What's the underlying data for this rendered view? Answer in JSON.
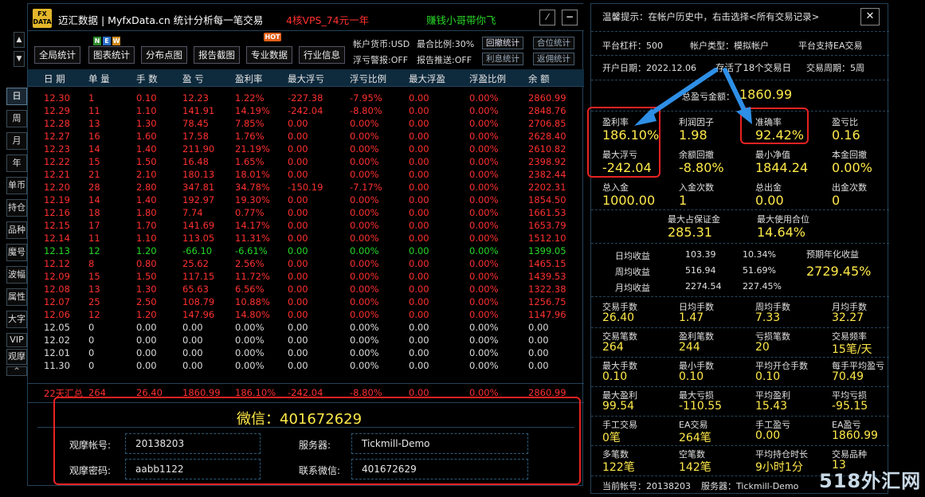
{
  "app": {
    "logo_text": "FX DATA",
    "title": "迈汇数据 | MyfxData.cn  统计分析每一笔交易",
    "ad1": "4核VPS_74元一年",
    "ad2": "赚钱小哥带你飞"
  },
  "toolbar": {
    "buttons": [
      "全局统计",
      "图表统计",
      "分布点图",
      "报告截图",
      "专业数据",
      "行业信息"
    ],
    "new_badge": [
      "N",
      "E",
      "W"
    ],
    "hot_badge": "HOT",
    "info": {
      "currency": "帐户货币:USD",
      "ratio": "最合比例:30%",
      "float_alert": "浮亏警报:OFF",
      "report_push": "报告推送:OFF"
    },
    "mini_buttons": [
      "回撤统计",
      "合位统计",
      "利息统计",
      "返佣统计"
    ]
  },
  "sidebar": {
    "arrows": [
      "▲",
      "▼"
    ],
    "items": [
      "日",
      "周",
      "月",
      "年",
      "单币",
      "持仓",
      "品种",
      "魔号",
      "波幅",
      "属性",
      "大字",
      "VIP",
      "观摩",
      "^"
    ]
  },
  "table": {
    "headers": [
      "日 期",
      "单 量",
      "手 数",
      "盈 亏",
      "盈利率",
      "最大浮亏",
      "浮亏比例",
      "最大浮盈",
      "浮盈比例",
      "余 额"
    ],
    "rows": [
      {
        "c": "red",
        "v": [
          "12.30",
          "1",
          "0.10",
          "12.23",
          "1.22%",
          "-227.38",
          "-7.95%",
          "0.00",
          "0.00%",
          "2860.99"
        ]
      },
      {
        "c": "red",
        "v": [
          "12.29",
          "11",
          "1.10",
          "141.91",
          "14.19%",
          "-242.04",
          "-8.80%",
          "0.00",
          "0.00%",
          "2848.76"
        ]
      },
      {
        "c": "red",
        "v": [
          "12.28",
          "13",
          "1.30",
          "78.45",
          "7.85%",
          "0.00",
          "0.00%",
          "0.00",
          "0.00%",
          "2706.85"
        ]
      },
      {
        "c": "red",
        "v": [
          "12.27",
          "16",
          "1.60",
          "17.58",
          "1.76%",
          "0.00",
          "0.00%",
          "0.00",
          "0.00%",
          "2628.40"
        ]
      },
      {
        "c": "red",
        "v": [
          "12.23",
          "14",
          "1.40",
          "211.90",
          "21.19%",
          "0.00",
          "0.00%",
          "0.00",
          "0.00%",
          "2610.82"
        ]
      },
      {
        "c": "red",
        "v": [
          "12.22",
          "15",
          "1.50",
          "16.48",
          "1.65%",
          "0.00",
          "0.00%",
          "0.00",
          "0.00%",
          "2398.92"
        ]
      },
      {
        "c": "red",
        "v": [
          "12.21",
          "21",
          "2.10",
          "180.13",
          "18.01%",
          "0.00",
          "0.00%",
          "0.00",
          "0.00%",
          "2382.44"
        ]
      },
      {
        "c": "red",
        "v": [
          "12.20",
          "28",
          "2.80",
          "347.81",
          "34.78%",
          "-150.19",
          "-7.17%",
          "0.00",
          "0.00%",
          "2202.31"
        ]
      },
      {
        "c": "red",
        "v": [
          "12.19",
          "14",
          "1.40",
          "192.97",
          "19.30%",
          "0.00",
          "0.00%",
          "0.00",
          "0.00%",
          "1854.50"
        ]
      },
      {
        "c": "red",
        "v": [
          "12.16",
          "18",
          "1.80",
          "7.74",
          "0.77%",
          "0.00",
          "0.00%",
          "0.00",
          "0.00%",
          "1661.53"
        ]
      },
      {
        "c": "red",
        "v": [
          "12.15",
          "17",
          "1.70",
          "141.69",
          "14.17%",
          "0.00",
          "0.00%",
          "0.00",
          "0.00%",
          "1653.79"
        ]
      },
      {
        "c": "red",
        "v": [
          "12.14",
          "11",
          "1.10",
          "113.05",
          "11.31%",
          "0.00",
          "0.00%",
          "0.00",
          "0.00%",
          "1512.10"
        ]
      },
      {
        "c": "green",
        "v": [
          "12.13",
          "12",
          "1.20",
          "-66.10",
          "-6.61%",
          "0.00",
          "0.00%",
          "0.00",
          "0.00%",
          "1399.05"
        ]
      },
      {
        "c": "red",
        "v": [
          "12.12",
          "8",
          "0.80",
          "25.62",
          "2.56%",
          "0.00",
          "0.00%",
          "0.00",
          "0.00%",
          "1465.15"
        ]
      },
      {
        "c": "red",
        "v": [
          "12.09",
          "15",
          "1.50",
          "117.15",
          "11.72%",
          "0.00",
          "0.00%",
          "0.00",
          "0.00%",
          "1439.53"
        ]
      },
      {
        "c": "red",
        "v": [
          "12.08",
          "13",
          "1.30",
          "65.63",
          "6.56%",
          "0.00",
          "0.00%",
          "0.00",
          "0.00%",
          "1322.38"
        ]
      },
      {
        "c": "red",
        "v": [
          "12.07",
          "25",
          "2.50",
          "108.79",
          "10.88%",
          "0.00",
          "0.00%",
          "0.00",
          "0.00%",
          "1256.75"
        ]
      },
      {
        "c": "red",
        "v": [
          "12.06",
          "12",
          "1.20",
          "147.96",
          "14.80%",
          "0.00",
          "0.00%",
          "0.00",
          "0.00%",
          "1147.96"
        ]
      },
      {
        "c": "white",
        "v": [
          "12.05",
          "0",
          "0.00",
          "0.00",
          "0.00%",
          "0.00",
          "0.00%",
          "0.00",
          "0.00%",
          "0.00"
        ]
      },
      {
        "c": "white",
        "v": [
          "12.02",
          "0",
          "0.00",
          "0.00",
          "0.00%",
          "0.00",
          "0.00%",
          "0.00",
          "0.00%",
          "0.00"
        ]
      },
      {
        "c": "white",
        "v": [
          "12.01",
          "0",
          "0.00",
          "0.00",
          "0.00%",
          "0.00",
          "0.00%",
          "0.00",
          "0.00%",
          "0.00"
        ]
      },
      {
        "c": "white",
        "v": [
          "11.30",
          "0",
          "0.00",
          "0.00",
          "0.00%",
          "0.00",
          "0.00%",
          "0.00",
          "0.00%",
          "0.00"
        ]
      }
    ],
    "summary": [
      "22天汇总",
      "264",
      "26.40",
      "1860.99",
      "186.10%",
      "-242.04",
      "-8.80%",
      "0.00",
      "0.00%",
      "2860.99"
    ]
  },
  "bottom": {
    "wechat_title": "微信：401672629",
    "login_label": "观摩帐号:",
    "login_value": "20138203",
    "pwd_label": "观摩密码:",
    "pwd_value": "aabb1122",
    "server_label": "服务器:",
    "server_value": "Tickmill-Demo",
    "contact_label": "联系微信:",
    "contact_value": "401672629"
  },
  "right": {
    "tip": "温馨提示：在帐户历史中，右击选择<所有交易记录>",
    "close": "✕",
    "leverage": "平台杠杆：500",
    "acc_type": "帐户类型：模拟帐户",
    "ea": "平台支持EA交易",
    "open_date": "开户日期：2022.12.06",
    "alive": "存活了18个交易日",
    "period": "交易周期：5周",
    "total_label": "总盈亏金额：",
    "total_value": "1860.99",
    "grid1": [
      [
        "盈利率",
        "186.10%"
      ],
      [
        "利润因子",
        "1.98"
      ],
      [
        "准确率",
        "92.42%"
      ],
      [
        "盈亏比",
        "0.16"
      ],
      [
        "最大浮亏",
        "-242.04"
      ],
      [
        "余额回撤",
        "-8.80%"
      ],
      [
        "最小净值",
        "1844.24"
      ],
      [
        "本金回撤",
        "0.00%"
      ],
      [
        "总入金",
        "1000.00"
      ],
      [
        "入金次数",
        "1"
      ],
      [
        "总出金",
        "0.00"
      ],
      [
        "出金次数",
        "0"
      ]
    ],
    "margin_label": "最大占保证金",
    "margin_value": "285.31",
    "maxpos_label": "最大使用合位",
    "maxpos_value": "14.64%",
    "avg": [
      [
        "日均收益",
        "103.39",
        "10.34%"
      ],
      [
        "周均收益",
        "516.94",
        "51.69%"
      ],
      [
        "月均收益",
        "2274.54",
        "227.45%"
      ]
    ],
    "annual_label": "预期年化收益",
    "annual_value": "2729.45%",
    "grid2": [
      [
        "交易手数",
        "26.40"
      ],
      [
        "日均手数",
        "1.47"
      ],
      [
        "周均手数",
        "7.33"
      ],
      [
        "月均手数",
        "32.27"
      ],
      [
        "交易笔数",
        "264"
      ],
      [
        "盈利笔数",
        "244"
      ],
      [
        "亏损笔数",
        "20"
      ],
      [
        "交易频率",
        "15笔/天"
      ],
      [
        "最大手数",
        "0.10"
      ],
      [
        "最小手数",
        "0.10"
      ],
      [
        "平均开仓手数",
        "0.10"
      ],
      [
        "每手平均盈亏",
        "70.49"
      ],
      [
        "最大盈利",
        "99.54"
      ],
      [
        "最大亏损",
        "-110.55"
      ],
      [
        "平均盈利",
        "15.43"
      ],
      [
        "平均亏损",
        "-95.15"
      ],
      [
        "手工交易",
        "0笔"
      ],
      [
        "EA交易",
        "264笔"
      ],
      [
        "手工盈亏",
        "0.00"
      ],
      [
        "EA盈亏",
        "1860.99"
      ],
      [
        "多笔数",
        "122笔"
      ],
      [
        "空笔数",
        "142笔"
      ],
      [
        "平均持仓时长",
        "9小时1分"
      ],
      [
        "交易品种",
        "13"
      ]
    ],
    "footer_acc": "当前帐号：20138203",
    "footer_server": "服务器：Tickmill-Demo"
  },
  "watermark": "518外汇网"
}
